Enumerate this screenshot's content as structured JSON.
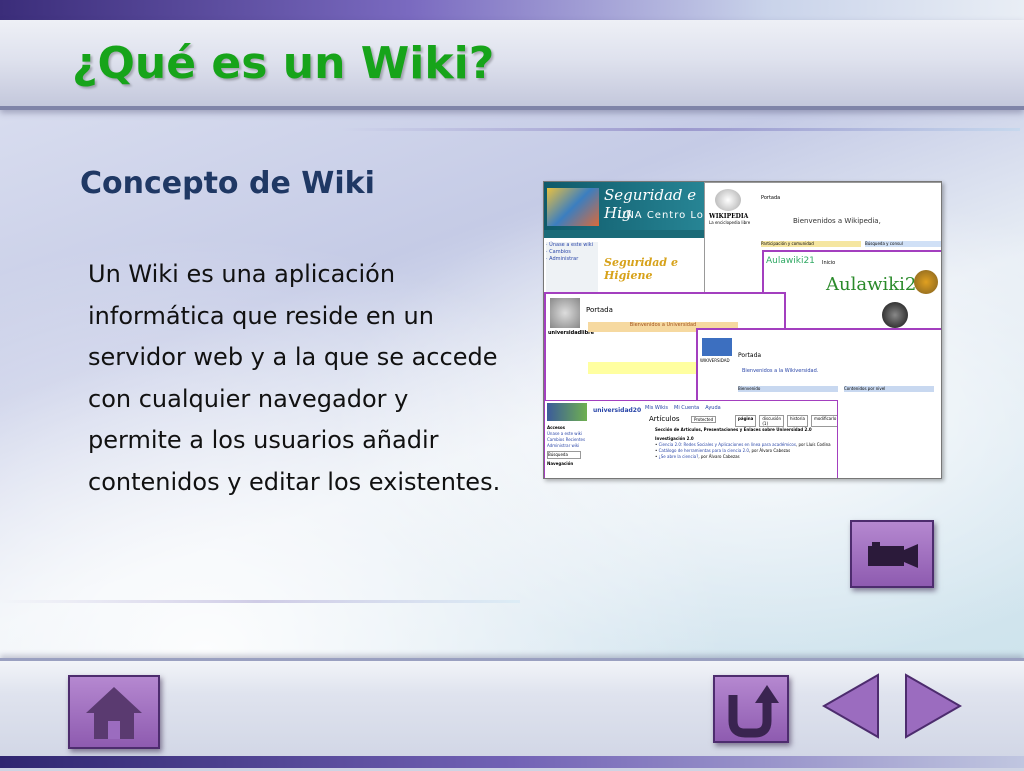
{
  "slide": {
    "title": "¿Qué es un Wiki?",
    "subtitle": "Concepto de Wiki",
    "body": "Un Wiki es una aplicación informática que reside en un servidor web y a la que se accede con cualquier navegador y permite a los usuarios añadir contenidos y editar los existentes."
  },
  "screenshot": {
    "win1": {
      "banner_title": "Seguridad e Hig",
      "banner_sub": "UNA Centro Loc",
      "logo": "Seguridad e Higiene"
    },
    "win2": {
      "logo": "WIKIPEDIA",
      "tagline": "La enciclopedia libre",
      "portal_tab": "Portada",
      "welcome": "Bienvenidos a Wikipedia,",
      "section1": "Participación y comunidad",
      "section2": "Búsqueda y consul"
    },
    "win3": {
      "logo": "Aulawiki21",
      "tab": "Inicio"
    },
    "win4": {
      "logo": "universidadlibre",
      "page": "Portada",
      "welcome": "Bienvenidos a Universidad"
    },
    "win5": {
      "logo": "WIKIVERSIDAD",
      "page": "Portada",
      "welcome": "Bienvenidos a la Wikiversidad.",
      "box1": "Bienvenido",
      "box2": "Contenidos por nivel"
    },
    "win6": {
      "logo": "universidad20",
      "tab_articles": "Artículos",
      "protected": "Protected",
      "tab_page": "página",
      "tab_discussion": "discusión (1)",
      "tab_history": "historia",
      "tab_edit": "modificarlo",
      "accesses": "Accesos",
      "links": [
        "Únase a este wiki",
        "Cambios Recientes",
        "Administrar wiki"
      ],
      "search": "Búsqueda",
      "nav": "Navegación",
      "section": "Sección de Artículos, Presentaciones y Enlaces sobre Universidad 2.0",
      "investigation": "Investigación 2.0",
      "items": [
        "Ciencia 2.0: Redes Sociales y Aplicaciones en línea para académicos",
        "Catálogo de herramientas para la ciencia 2.0",
        "¿Se abre la ciencia?"
      ],
      "authors": [
        ", por Lluís Codina",
        ", por Álvaro Cabezas",
        ", por Álvaro Cabezas"
      ],
      "user_links": [
        "Mis Wikis",
        "Mi Cuenta",
        "Ayuda"
      ]
    }
  },
  "nav": {
    "video_icon": "video-camera-icon",
    "home_icon": "home-icon",
    "return_icon": "return-icon",
    "prev_icon": "triangle-left-icon",
    "next_icon": "triangle-right-icon"
  },
  "colors": {
    "title": "#17a41a",
    "subtitle": "#1f3864",
    "button": "#9b6cbf"
  }
}
